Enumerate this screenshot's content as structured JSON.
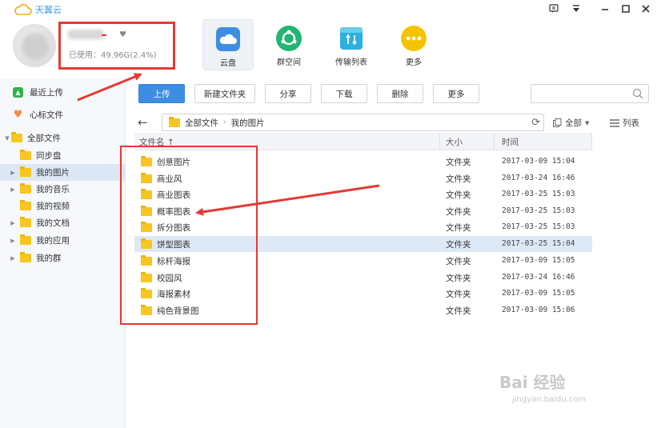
{
  "app": {
    "title": "天翼云"
  },
  "account": {
    "usage_text": "已使用：49.96G(2.4%)"
  },
  "main_tabs": [
    {
      "label": "云盘",
      "icon": "cloud-icon",
      "color": "#3d8ee0"
    },
    {
      "label": "群空间",
      "icon": "group-space-icon",
      "color": "#22b573"
    },
    {
      "label": "传输列表",
      "icon": "transfer-icon",
      "color": "#2bb0e0"
    },
    {
      "label": "更多",
      "icon": "more-icon",
      "color": "#f5c400"
    }
  ],
  "sidebar": {
    "recent": "最近上传",
    "favorites": "心标文件",
    "all_files": "全部文件",
    "folders": [
      "同步盘",
      "我的图片",
      "我的音乐",
      "我的视频",
      "我的文档",
      "我的应用",
      "我的群"
    ]
  },
  "toolbar": {
    "upload": "上传",
    "new_folder": "新建文件夹",
    "share": "分享",
    "download": "下载",
    "delete": "删除",
    "more": "更多"
  },
  "path": {
    "root": "全部文件",
    "current": "我的图片"
  },
  "view": {
    "filter": "全部",
    "mode": "列表"
  },
  "table": {
    "headers": {
      "name": "文件名 ↑",
      "size": "大小",
      "time": "时间"
    },
    "rows": [
      {
        "name": "创意图片",
        "type": "文件夹",
        "time": "2017-03-09 15:04"
      },
      {
        "name": "商业风",
        "type": "文件夹",
        "time": "2017-03-24 16:46"
      },
      {
        "name": "商业图表",
        "type": "文件夹",
        "time": "2017-03-25 15:03"
      },
      {
        "name": "概率图表",
        "type": "文件夹",
        "time": "2017-03-25 15:03"
      },
      {
        "name": "拆分图表",
        "type": "文件夹",
        "time": "2017-03-25 15:03"
      },
      {
        "name": "饼型图表",
        "type": "文件夹",
        "time": "2017-03-25 15:04"
      },
      {
        "name": "标杆海报",
        "type": "文件夹",
        "time": "2017-03-09 15:05"
      },
      {
        "name": "校园风",
        "type": "文件夹",
        "time": "2017-03-24 16:46"
      },
      {
        "name": "海报素材",
        "type": "文件夹",
        "time": "2017-03-09 15:05"
      },
      {
        "name": "纯色背景图",
        "type": "文件夹",
        "time": "2017-03-09 15:06"
      }
    ]
  },
  "watermark": {
    "main": "Bai 经验",
    "sub": "jingyan.baidu.com"
  },
  "colors": {
    "accent": "#3d8ee0",
    "annotation": "#e53935",
    "selected": "#dde9f7"
  }
}
